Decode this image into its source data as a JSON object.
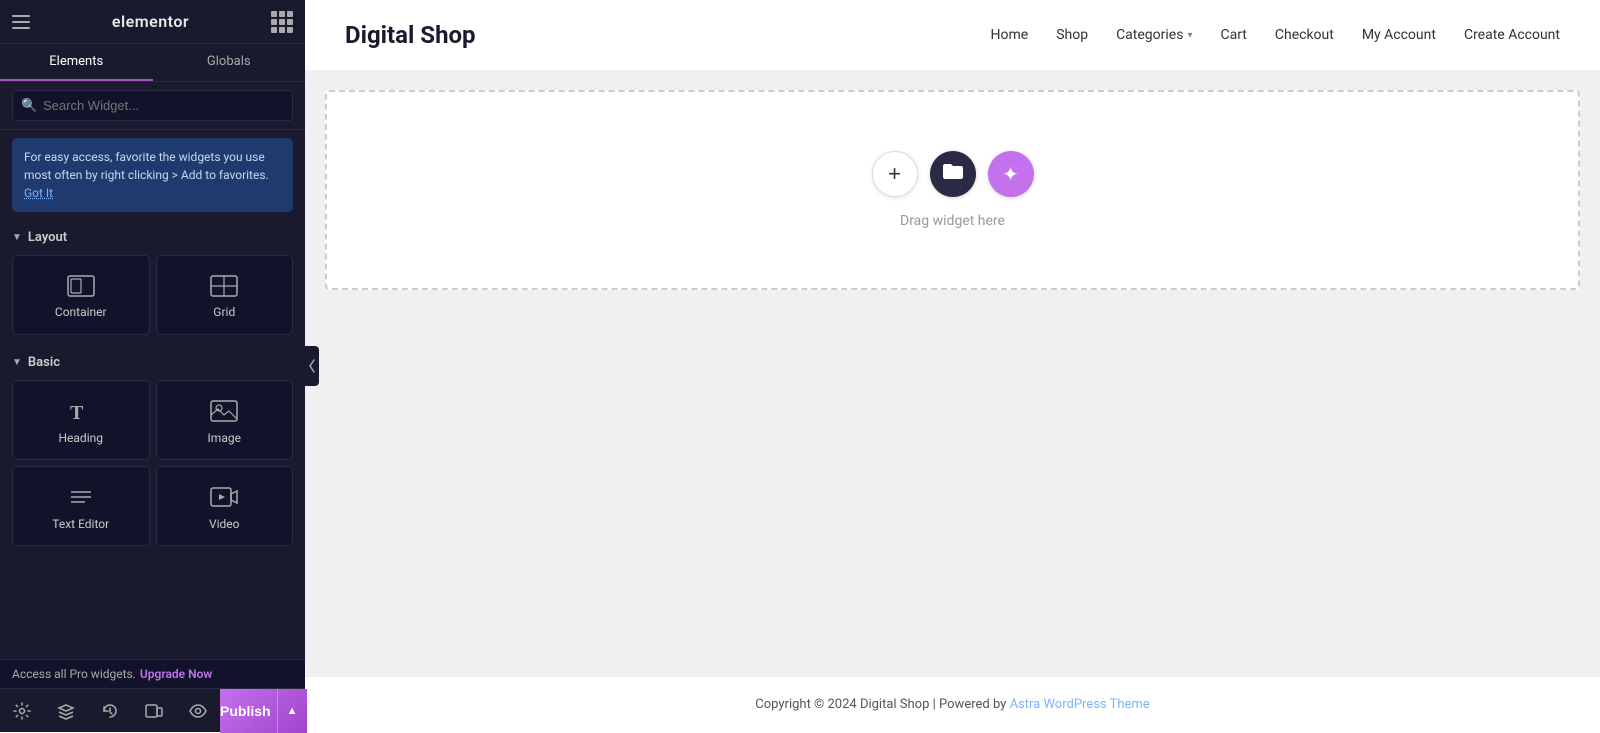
{
  "topBar": {
    "logo": "elementor",
    "gridIconLabel": "apps-grid"
  },
  "tabs": {
    "elements": "Elements",
    "globals": "Globals",
    "activeTab": "elements"
  },
  "search": {
    "placeholder": "Search Widget...",
    "value": ""
  },
  "infoBox": {
    "message": "For easy access, favorite the widgets you use most often by right clicking > Add to favorites.",
    "gotIt": "Got It"
  },
  "layout": {
    "sectionLabel": "Layout",
    "widgets": [
      {
        "name": "Container",
        "icon": "container"
      },
      {
        "name": "Grid",
        "icon": "grid"
      }
    ]
  },
  "basic": {
    "sectionLabel": "Basic",
    "widgets": [
      {
        "name": "Heading",
        "icon": "heading"
      },
      {
        "name": "Image",
        "icon": "image"
      },
      {
        "name": "Text Editor",
        "icon": "text-editor"
      },
      {
        "name": "Video",
        "icon": "video"
      }
    ]
  },
  "canvas": {
    "dropHint": "Drag widget here",
    "addBtn": "+",
    "templateBtn": "📁",
    "magicBtn": "✦"
  },
  "nav": {
    "siteName": "Digital Shop",
    "items": [
      {
        "label": "Home",
        "hasDropdown": false
      },
      {
        "label": "Shop",
        "hasDropdown": false
      },
      {
        "label": "Categories",
        "hasDropdown": true
      },
      {
        "label": "Cart",
        "hasDropdown": false
      },
      {
        "label": "Checkout",
        "hasDropdown": false
      },
      {
        "label": "My Account",
        "hasDropdown": false
      },
      {
        "label": "Create Account",
        "hasDropdown": false
      }
    ]
  },
  "footer": {
    "text": "Copyright © 2024 Digital Shop | Powered by ",
    "linkText": "Astra WordPress Theme",
    "linkUrl": "#"
  },
  "bottomToolbar": {
    "icons": [
      {
        "name": "settings-icon",
        "symbol": "⚙"
      },
      {
        "name": "layers-icon",
        "symbol": "◧"
      },
      {
        "name": "history-icon",
        "symbol": "↺"
      },
      {
        "name": "responsive-icon",
        "symbol": "⊞"
      },
      {
        "name": "eye-icon",
        "symbol": "◉"
      }
    ],
    "publishLabel": "Publish",
    "expandLabel": "▲"
  },
  "proBar": {
    "message": "Access all Pro widgets.",
    "upgradeLabel": "Upgrade Now"
  },
  "colors": {
    "accent": "#c471ed",
    "panelBg": "#1a1a2e",
    "linkColor": "#7eb3ff"
  }
}
